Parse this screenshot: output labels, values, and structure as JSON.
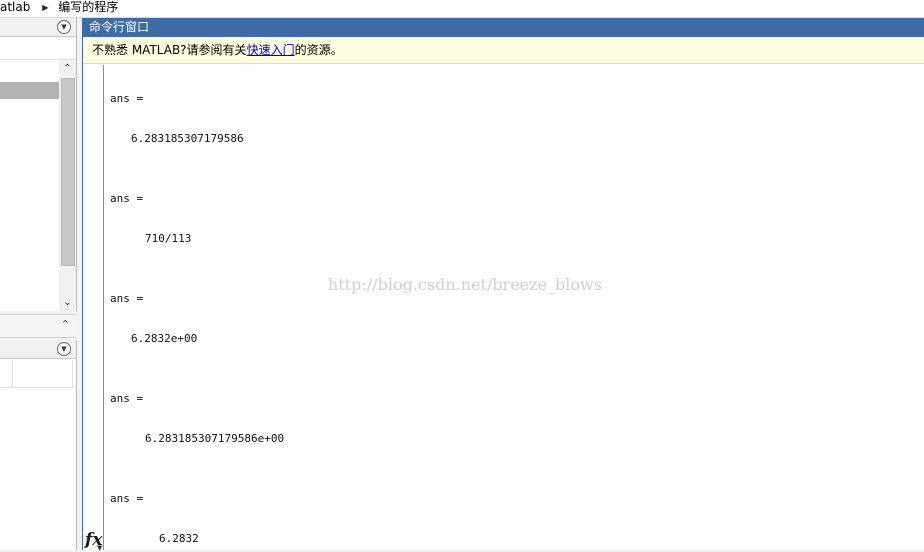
{
  "breadcrumb": {
    "items": [
      "atlab",
      "编写的程序"
    ]
  },
  "command_window": {
    "title": "命令行窗口",
    "banner": {
      "prefix": "不熟悉 MATLAB?请参阅有关",
      "link": "快速入门",
      "suffix": "的资源。"
    },
    "prompt_icon": "fx",
    "outputs": [
      {
        "label": "ans =",
        "value": "6.283185307179586"
      },
      {
        "label": "ans =",
        "value": "710/113"
      },
      {
        "label": "ans =",
        "value": "6.2832e+00"
      },
      {
        "label": "ans =",
        "value": "6.283185307179586e+00"
      },
      {
        "label": "ans =",
        "value": "6.2832"
      }
    ]
  },
  "watermark": "http://blog.csdn.net/breeze_blows",
  "icons": {
    "breadcrumb_separator": "triangle-right-icon",
    "panel_menu": "circle-down-icon",
    "scroll_up": "chevron-up-icon",
    "scroll_down": "chevron-down-icon",
    "collapse": "chevron-up-icon",
    "function_browser": "fx-icon"
  },
  "colors": {
    "title_bar": "#3d6da3",
    "banner_bg": "#fdfbe0",
    "link": "#0000ee"
  }
}
